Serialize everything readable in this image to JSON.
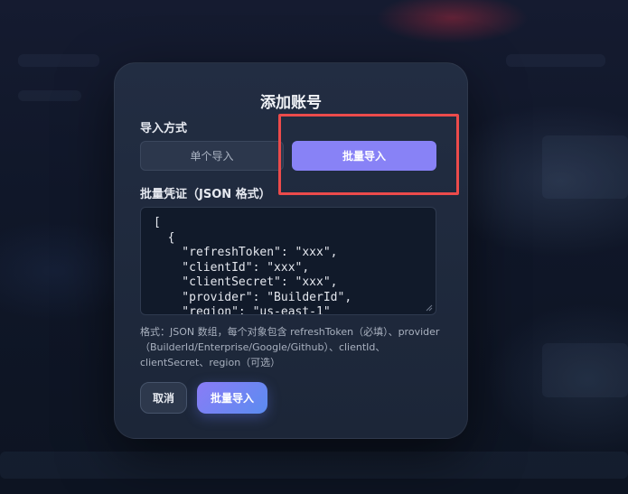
{
  "dialog": {
    "title": "添加账号",
    "import_mode_label": "导入方式",
    "modes": {
      "single": "单个导入",
      "batch": "批量导入",
      "selected": "batch"
    },
    "credentials_label": "批量凭证（JSON 格式）",
    "credentials_value": "[\n  {\n    \"refreshToken\": \"xxx\",\n    \"clientId\": \"xxx\",\n    \"clientSecret\": \"xxx\",\n    \"provider\": \"BuilderId\",\n    \"region\": \"us-east-1\"",
    "hint": "格式：JSON 数组，每个对象包含 refreshToken（必填）、provider（BuilderId/Enterprise/Google/Github）、clientId、clientSecret、region（可选）",
    "cancel_label": "取消",
    "submit_label": "批量导入"
  },
  "colors": {
    "accent": "#8882f6",
    "highlight": "#ec4b4b",
    "modal_bg": "#1f2a3d"
  },
  "icons": {
    "resize": "resize-handle-icon"
  }
}
